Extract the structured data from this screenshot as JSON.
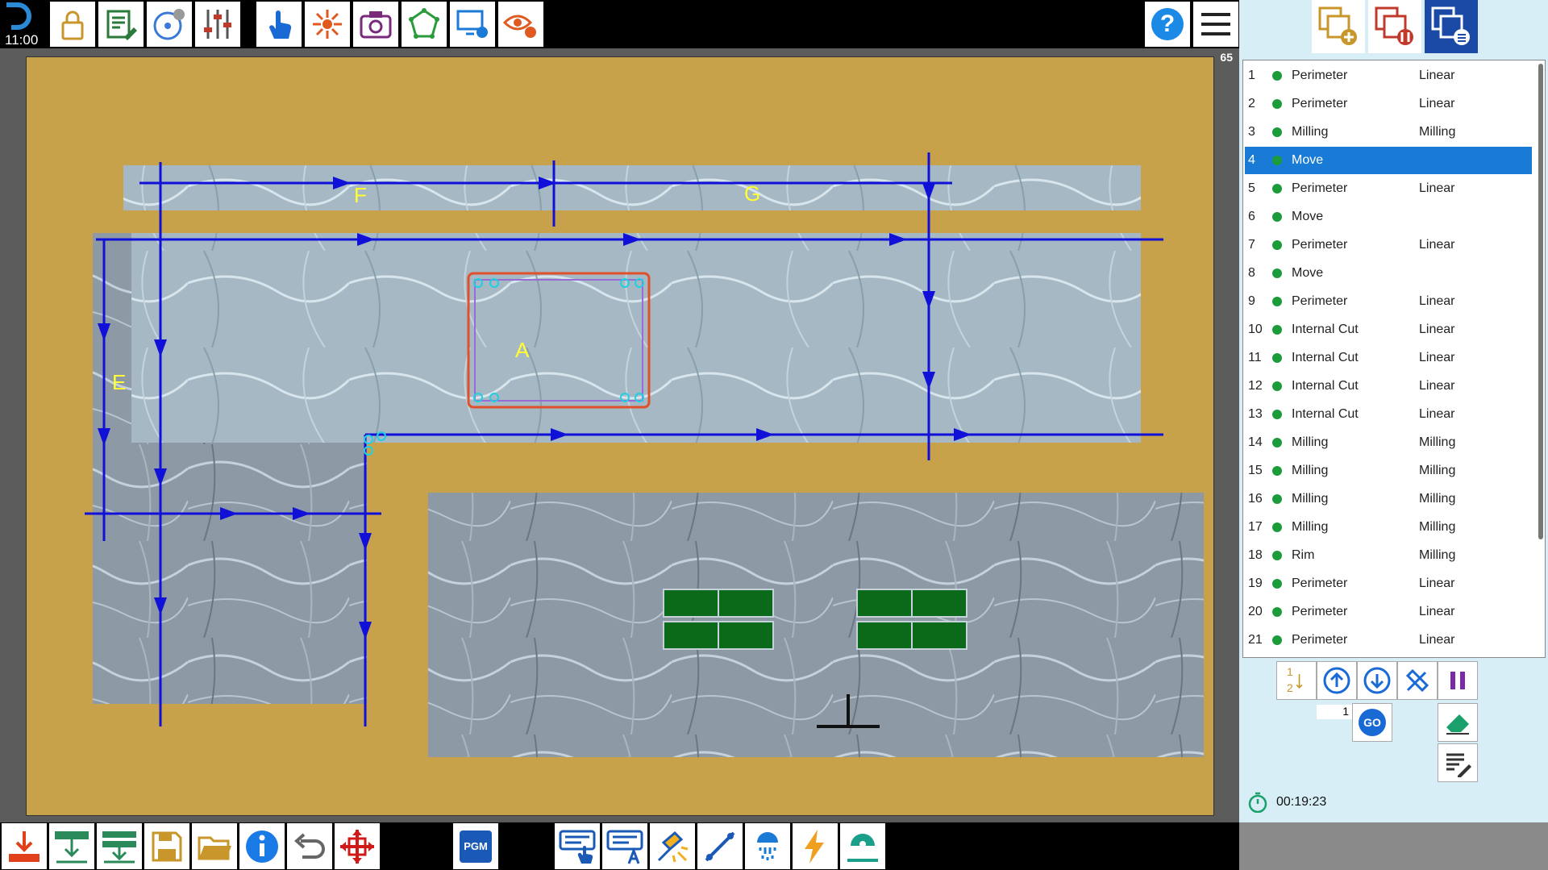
{
  "clock": "11:00",
  "zoom": "65",
  "canvas": {
    "labels": [
      "F",
      "G",
      "E",
      "A"
    ],
    "colors": {
      "table": "#c8a24a",
      "path": "#1010d8",
      "label": "#ffff33",
      "selected_outline": "#e0502a",
      "handles": "#20d0e0",
      "vacuum": "#0a6a1a"
    }
  },
  "top_toolbar": [
    {
      "name": "lock-icon",
      "color": "#c8962a"
    },
    {
      "name": "edit-list-icon",
      "color": "#2a7a3a"
    },
    {
      "name": "disk-settings-icon",
      "color": "#3a7ad6"
    },
    {
      "name": "sliders-icon",
      "color": "#c0392b"
    },
    {
      "name": "touch-icon",
      "color": "#1a6ad6"
    },
    {
      "name": "laser-icon",
      "color": "#e05a20"
    },
    {
      "name": "camera-icon",
      "color": "#7a2a7a"
    },
    {
      "name": "shape-icon",
      "color": "#2a9a3a"
    },
    {
      "name": "display-settings-icon",
      "color": "#1a7ad6"
    },
    {
      "name": "view-settings-icon",
      "color": "#e05a20"
    }
  ],
  "help_label": "?",
  "bottom_toolbar": {
    "pgm_label": "PGM",
    "items": [
      "download-icon",
      "load-table-icon",
      "unload-table-icon",
      "save-icon",
      "open-folder-icon",
      "info-icon",
      "undo-icon",
      "move-cross-icon"
    ]
  },
  "operations": [
    {
      "num": "1",
      "name": "Perimeter",
      "type": "Linear"
    },
    {
      "num": "2",
      "name": "Perimeter",
      "type": "Linear"
    },
    {
      "num": "3",
      "name": "Milling",
      "type": "Milling"
    },
    {
      "num": "4",
      "name": "Move",
      "type": "",
      "selected": true
    },
    {
      "num": "5",
      "name": "Perimeter",
      "type": "Linear"
    },
    {
      "num": "6",
      "name": "Move",
      "type": ""
    },
    {
      "num": "7",
      "name": "Perimeter",
      "type": "Linear"
    },
    {
      "num": "8",
      "name": "Move",
      "type": ""
    },
    {
      "num": "9",
      "name": "Perimeter",
      "type": "Linear"
    },
    {
      "num": "10",
      "name": "Internal Cut",
      "type": "Linear"
    },
    {
      "num": "11",
      "name": "Internal Cut",
      "type": "Linear"
    },
    {
      "num": "12",
      "name": "Internal Cut",
      "type": "Linear"
    },
    {
      "num": "13",
      "name": "Internal Cut",
      "type": "Linear"
    },
    {
      "num": "14",
      "name": "Milling",
      "type": "Milling"
    },
    {
      "num": "15",
      "name": "Milling",
      "type": "Milling"
    },
    {
      "num": "16",
      "name": "Milling",
      "type": "Milling"
    },
    {
      "num": "17",
      "name": "Milling",
      "type": "Milling"
    },
    {
      "num": "18",
      "name": "Rim",
      "type": "Milling"
    },
    {
      "num": "19",
      "name": "Perimeter",
      "type": "Linear"
    },
    {
      "num": "20",
      "name": "Perimeter",
      "type": "Linear"
    },
    {
      "num": "21",
      "name": "Perimeter",
      "type": "Linear"
    }
  ],
  "controls": {
    "step_value": "1",
    "go_label": "GO",
    "order_top": "1",
    "order_bottom": "2"
  },
  "timer": "00:19:23"
}
